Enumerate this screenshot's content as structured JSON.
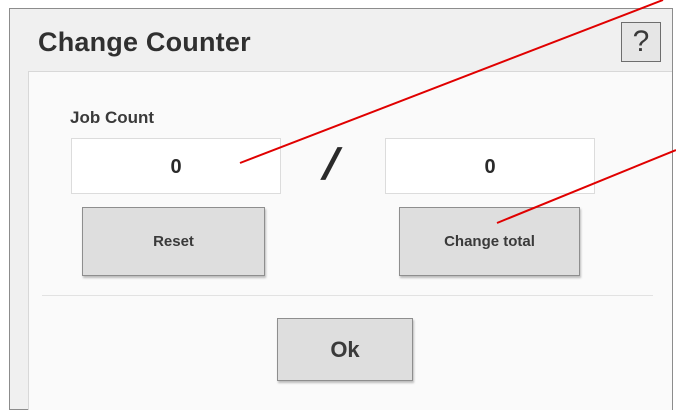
{
  "dialog": {
    "title": "Change Counter",
    "help_label": "?"
  },
  "counter": {
    "label": "Job Count",
    "current_count": "0",
    "separator": "/",
    "total_count": "0"
  },
  "buttons": {
    "reset_label": "Reset",
    "change_total_label": "Change total",
    "ok_label": "Ok"
  },
  "colors": {
    "annotation_line": "#e00000",
    "dialog_background": "#f0f0f0",
    "button_background": "#dedede"
  }
}
